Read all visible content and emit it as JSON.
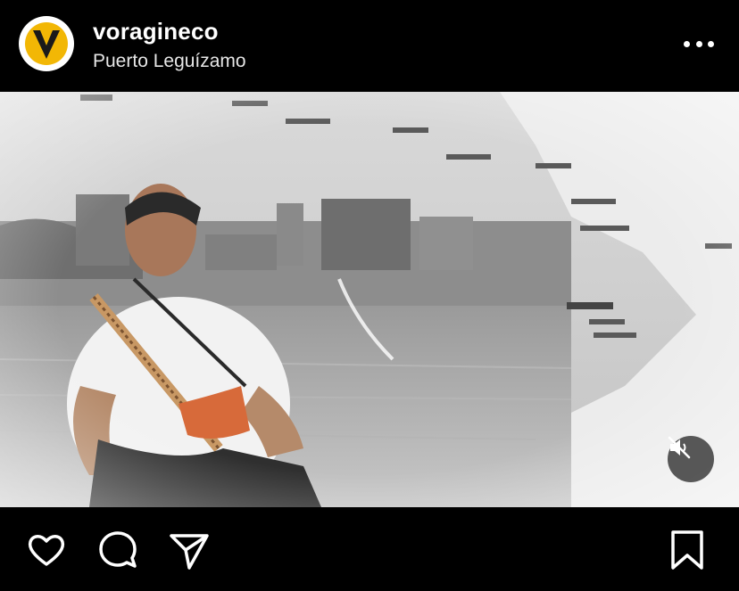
{
  "post": {
    "username": "voragineco",
    "location": "Puerto Leguízamo"
  },
  "icons": {
    "avatar": "voragine-logo",
    "more": "more-icon",
    "mute": "muted-speaker-icon",
    "like": "heart-icon",
    "comment": "comment-icon",
    "share": "paper-plane-icon",
    "save": "bookmark-icon"
  },
  "colors": {
    "background": "#000000",
    "logo_yellow": "#f2b705",
    "text": "#ffffff"
  }
}
